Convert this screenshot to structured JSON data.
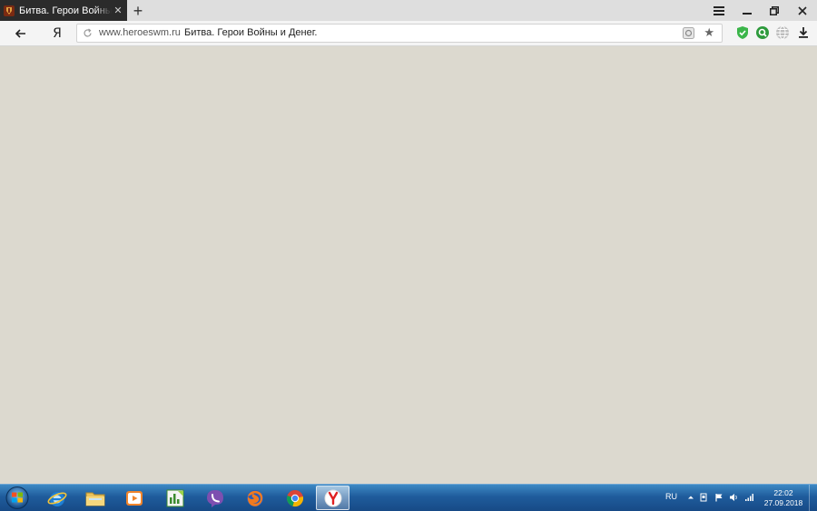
{
  "browser": {
    "tab": {
      "title": "Битва. Герои Войны и Денег",
      "close": "✕"
    },
    "new_tab": "+",
    "window_controls": {
      "menu": "☰",
      "minimize": "–",
      "restore": "❐",
      "close": "✕"
    },
    "toolbar": {
      "back": "←",
      "logo": "Я",
      "url": "www.heroeswm.ru",
      "page_title": "Битва. Герои Войны и Денег.",
      "bookmark": "★"
    },
    "extensions": [
      "shield-icon",
      "search-ext-icon",
      "globe-icon",
      "download-icon"
    ]
  },
  "taskbar": {
    "pinned": [
      "internet-explorer-icon",
      "file-explorer-icon",
      "media-player-icon",
      "chart-app-icon",
      "viber-icon",
      "firefox-icon",
      "chrome-icon",
      "yandex-browser-icon"
    ],
    "language": "RU",
    "time": "22:02",
    "date": "27.09.2018"
  },
  "colors": {
    "content_bg": "#dcd9cf",
    "tab_active": "#2b2b2b",
    "taskbar": "#1f5c9c"
  }
}
